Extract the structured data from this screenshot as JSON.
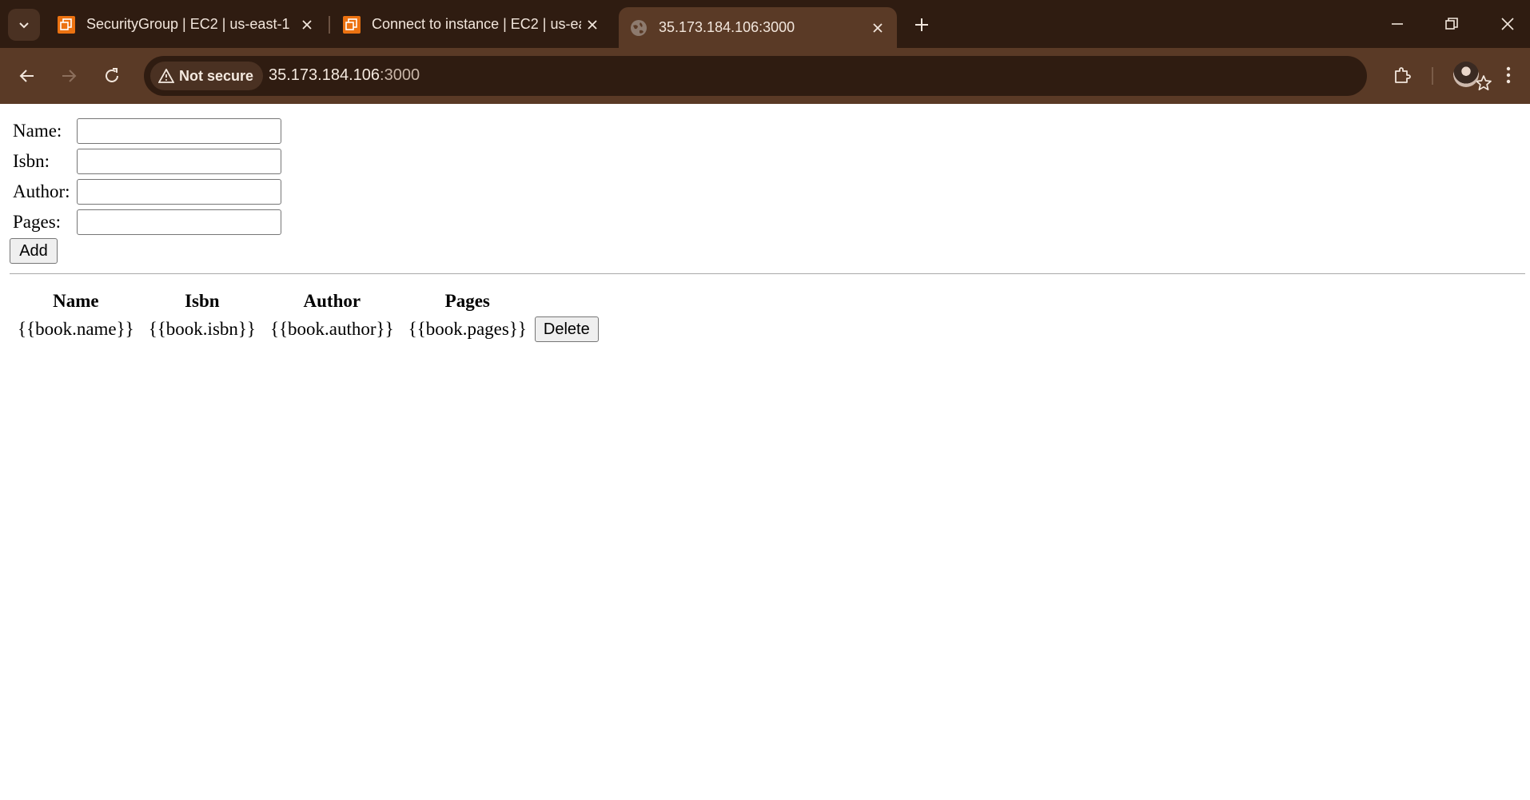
{
  "browser": {
    "tabs": [
      {
        "title": "SecurityGroup | EC2 | us-east-1",
        "favicon": "aws-ec2-icon",
        "active": false
      },
      {
        "title": "Connect to instance | EC2 | us-east-1",
        "favicon": "aws-ec2-icon",
        "active": false
      },
      {
        "title": "35.173.184.106:3000",
        "favicon": "globe-icon",
        "active": true
      }
    ],
    "security_label": "Not secure",
    "url_host": "35.173.184.106",
    "url_port": ":3000",
    "colors": {
      "tabstrip_bg": "#2f1c11",
      "toolbar_bg": "#5a3a26",
      "aws_orange": "#ec7211"
    }
  },
  "form": {
    "name_label": "Name:",
    "isbn_label": "Isbn:",
    "author_label": "Author:",
    "pages_label": "Pages:",
    "name_value": "",
    "isbn_value": "",
    "author_value": "",
    "pages_value": "",
    "add_label": "Add"
  },
  "table": {
    "headers": [
      "Name",
      "Isbn",
      "Author",
      "Pages"
    ],
    "rows": [
      {
        "name": "{{book.name}}",
        "isbn": "{{book.isbn}}",
        "author": "{{book.author}}",
        "pages": "{{book.pages}}",
        "delete_label": "Delete"
      }
    ]
  }
}
